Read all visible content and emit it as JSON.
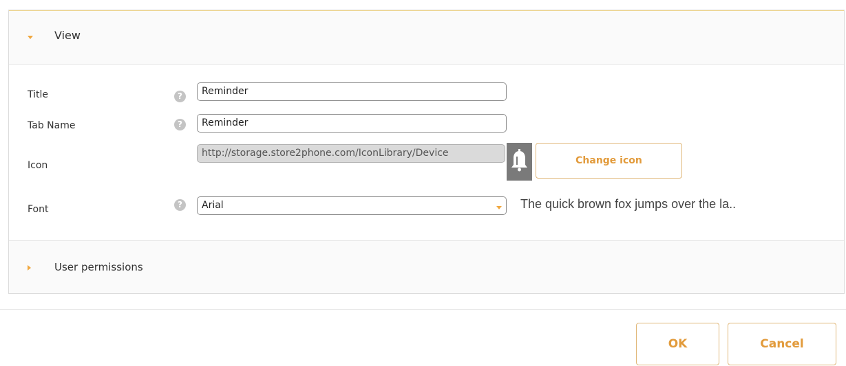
{
  "sections": {
    "view": {
      "label": "View",
      "expanded": true
    },
    "permissions": {
      "label": "User permissions",
      "expanded": false
    }
  },
  "form": {
    "title": {
      "label": "Title",
      "value": "Reminder",
      "help_icon": "question-circle-icon"
    },
    "tab_name": {
      "label": "Tab Name",
      "value": "Reminder",
      "help_icon": "question-circle-icon"
    },
    "icon": {
      "label": "Icon",
      "value": "http://storage.store2phone.com/IconLibrary/Device",
      "preview_icon": "bell-icon",
      "change_label": "Change icon"
    },
    "font": {
      "label": "Font",
      "value": "Arial",
      "help_icon": "question-circle-icon",
      "preview_text": "The quick brown fox jumps over the la.."
    }
  },
  "footer": {
    "ok_label": "OK",
    "cancel_label": "Cancel"
  },
  "colors": {
    "accent": "#e29b3c",
    "header_border": "#f1d68c",
    "icon_bg": "#7a7a7a"
  }
}
